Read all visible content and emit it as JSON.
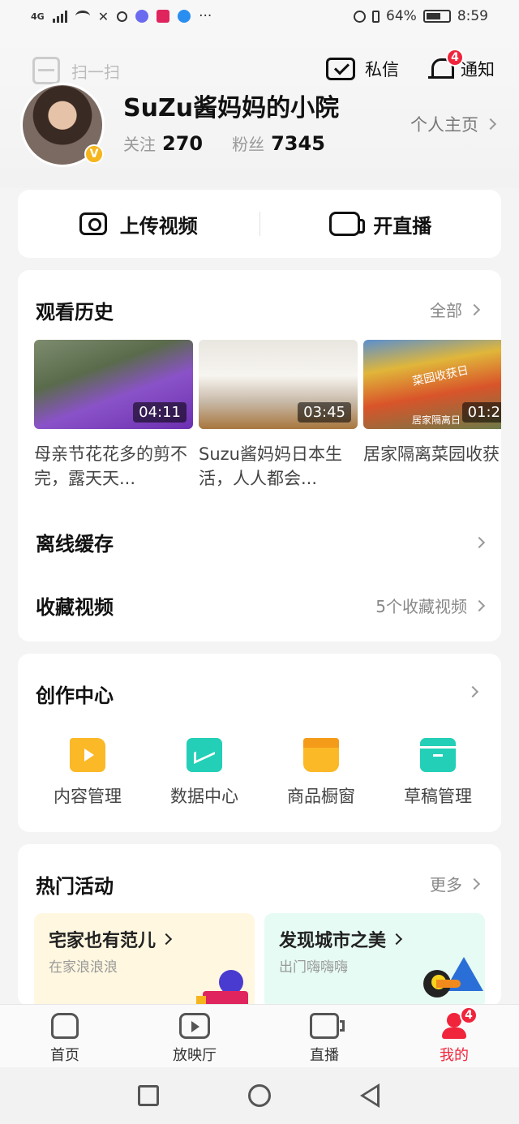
{
  "status_bar": {
    "network": "4G",
    "battery_percent": "64%",
    "battery_level": 0.64,
    "time": "8:59",
    "more": "···"
  },
  "header": {
    "scan_label": "扫一扫",
    "messages_label": "私信",
    "notify_label": "通知",
    "notify_badge": "4"
  },
  "profile": {
    "username": "SuZu酱妈妈的小院",
    "verified_badge": "V",
    "following_label": "关注",
    "following_count": "270",
    "followers_label": "粉丝",
    "followers_count": "7345",
    "homepage_link": "个人主页"
  },
  "actions": {
    "upload_label": "上传视频",
    "live_label": "开直播"
  },
  "history": {
    "title": "观看历史",
    "more_label": "全部",
    "videos": [
      {
        "duration": "04:11",
        "title": "母亲节花花多的剪不完，露天天..."
      },
      {
        "duration": "03:45",
        "title": "Suzu酱妈妈日本生活，人人都会..."
      },
      {
        "duration": "01:2",
        "title": "居家隔离菜园收获日，自媒体主...",
        "overlay_text": "菜园收获日",
        "overlay_sub": "居家隔离日"
      }
    ],
    "offline_label": "离线缓存",
    "favorites_label": "收藏视频",
    "favorites_count": "5个收藏视频"
  },
  "creator": {
    "title": "创作中心",
    "tools": [
      {
        "label": "内容管理",
        "color": "#fbb827"
      },
      {
        "label": "数据中心",
        "color": "#23cfb6"
      },
      {
        "label": "商品橱窗",
        "color": "#fbb827"
      },
      {
        "label": "草稿管理",
        "color": "#23cfb6"
      }
    ]
  },
  "activities": {
    "title": "热门活动",
    "more_label": "更多",
    "items": [
      {
        "title": "宅家也有范儿",
        "subtitle": "在家浪浪浪",
        "bg": "#fff7e0"
      },
      {
        "title": "发现城市之美",
        "subtitle": "出门嗨嗨嗨",
        "bg": "#e6fbf4"
      }
    ]
  },
  "tabbar": {
    "tabs": [
      {
        "label": "首页"
      },
      {
        "label": "放映厅"
      },
      {
        "label": "直播"
      },
      {
        "label": "我的",
        "badge": "4"
      }
    ]
  },
  "colors": {
    "accent": "#f0243b",
    "verified": "#f6b51d"
  }
}
